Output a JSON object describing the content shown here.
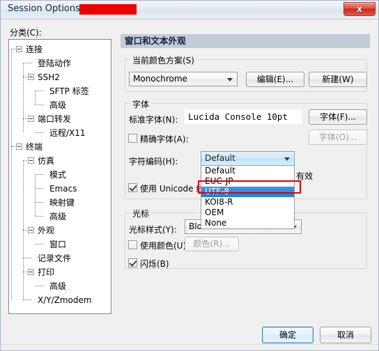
{
  "window": {
    "title_prefix": "Session Options - ",
    "redacted_label": "",
    "close_label": "x",
    "accent_red": "#ee0000",
    "header_bar_color": "#c3cbd8"
  },
  "left": {
    "category_label": "分类(C):",
    "tree": [
      {
        "label": "连接",
        "depth": 0,
        "expandable": true
      },
      {
        "label": "登陆动作",
        "depth": 1,
        "expandable": false
      },
      {
        "label": "SSH2",
        "depth": 1,
        "expandable": true
      },
      {
        "label": "SFTP 标签",
        "depth": 2,
        "expandable": false
      },
      {
        "label": "高级",
        "depth": 2,
        "expandable": false
      },
      {
        "label": "端口转发",
        "depth": 1,
        "expandable": true
      },
      {
        "label": "远程/X11",
        "depth": 2,
        "expandable": false
      },
      {
        "label": "终端",
        "depth": 0,
        "expandable": true
      },
      {
        "label": "仿真",
        "depth": 1,
        "expandable": true
      },
      {
        "label": "模式",
        "depth": 2,
        "expandable": false
      },
      {
        "label": "Emacs",
        "depth": 2,
        "expandable": false
      },
      {
        "label": "映射键",
        "depth": 2,
        "expandable": false
      },
      {
        "label": "高级",
        "depth": 2,
        "expandable": false
      },
      {
        "label": "外观",
        "depth": 1,
        "expandable": true
      },
      {
        "label": "窗口",
        "depth": 2,
        "expandable": false
      },
      {
        "label": "记录文件",
        "depth": 1,
        "expandable": false
      },
      {
        "label": "打印",
        "depth": 1,
        "expandable": true
      },
      {
        "label": "高级",
        "depth": 2,
        "expandable": false
      },
      {
        "label": "X/Y/Zmodem",
        "depth": 1,
        "expandable": false
      }
    ]
  },
  "panel": {
    "header": "窗口和文本外观",
    "color_scheme": {
      "group_title": "当前颜色方案(S)",
      "combo_value": "Monochrome",
      "edit_button": "编辑(E)...",
      "new_button": "新建(W)"
    },
    "font": {
      "group_title": "字体",
      "normal_font_label": "标准字体(N):",
      "normal_font_value": "Lucida Console 10pt",
      "font_button": "字体(F)...",
      "exact_font_label": "精确字体(A):",
      "exact_font_checked": false,
      "exact_font_button": "字体(O)...",
      "encoding_label": "字符编码(H):",
      "encoding_value": "Default",
      "encoding_options": [
        "Default",
        "EUC-JP",
        "UTF-8",
        "KOI8-R",
        "OEM",
        "None"
      ],
      "encoding_selected": "UTF-8",
      "unicode_line_label": "使用 Unicode 线条",
      "unicode_line_tail": "有效",
      "unicode_line_checked": true
    },
    "cursor": {
      "group_title": "光标",
      "style_label": "光标样式(Y):",
      "style_value": "Block",
      "use_color_label": "使用颜色(U):",
      "use_color_checked": false,
      "color_button": "颜色(R)...",
      "blink_label": "闪烁(B)",
      "blink_checked": true
    }
  },
  "footer": {
    "ok_button": "确定",
    "cancel_button": "取消"
  }
}
